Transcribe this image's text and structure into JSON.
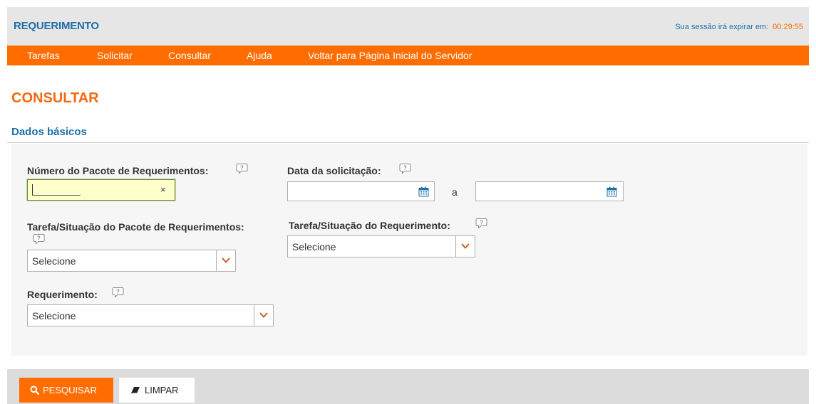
{
  "header": {
    "title": "REQUERIMENTO",
    "session_label": "Sua sessão irá expirar em:",
    "session_timer": "00:29:55"
  },
  "nav": {
    "items": [
      {
        "label": "Tarefas"
      },
      {
        "label": "Solicitar"
      },
      {
        "label": "Consultar"
      },
      {
        "label": "Ajuda"
      },
      {
        "label": "Voltar para Página Inicial do Servidor"
      }
    ]
  },
  "page": {
    "title": "CONSULTAR",
    "section": "Dados básicos"
  },
  "form": {
    "numero_label": "Número do Pacote de Requerimentos:",
    "numero_value": "",
    "numero_clear": "×",
    "data_label": "Data da solicitação:",
    "data_from_value": "",
    "data_sep": "a",
    "data_to_value": "",
    "tarefa_pacote_label": "Tarefa/Situação do Pacote de Requerimentos:",
    "tarefa_pacote_selected": "Selecione",
    "tarefa_req_label": "Tarefa/Situação do Requerimento:",
    "tarefa_req_selected": "Selecione",
    "requerimento_label": "Requerimento:",
    "requerimento_selected": "Selecione"
  },
  "actions": {
    "search_label": "PESQUISAR",
    "clear_label": "LIMPAR"
  },
  "icons": {
    "help": "help-bubble-icon",
    "calendar": "calendar-icon",
    "chevron": "chevron-down-icon",
    "search": "search-icon",
    "eraser": "eraser-icon"
  },
  "colors": {
    "brand_blue": "#1f6fa8",
    "accent_orange": "#ff6c00",
    "title_orange": "#f26a10",
    "focus_yellow": "#ffffcc"
  }
}
